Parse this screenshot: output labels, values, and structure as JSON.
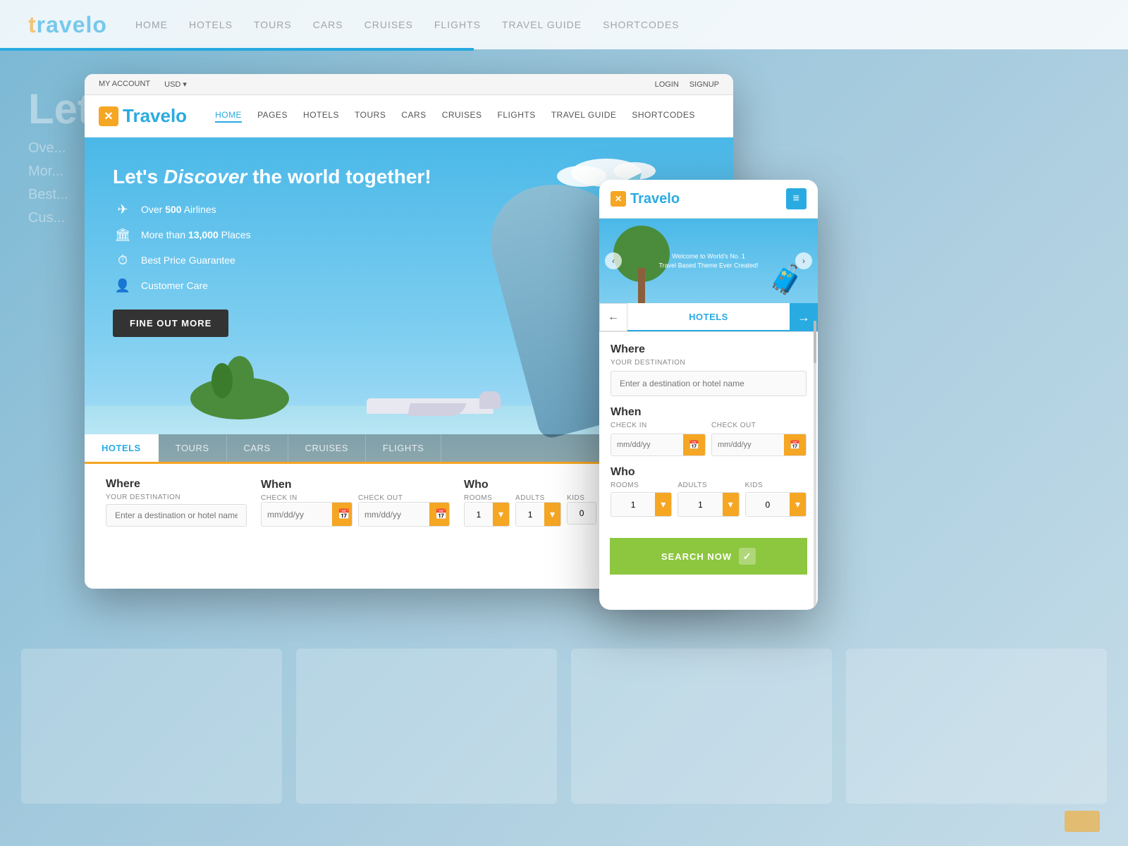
{
  "background": {
    "nav": {
      "logo": "Travelo",
      "logo_prefix": "t",
      "items": [
        "HOME",
        "HOTELS",
        "TOURS",
        "CARS",
        "CRUISES",
        "FLIGHTS",
        "TRAVEL GUIDE",
        "SHORTCODES"
      ]
    },
    "hero": {
      "title_prefix": "Let's",
      "title_highlight": "Discover",
      "title_suffix": "the world together!"
    }
  },
  "desktop": {
    "topbar": {
      "my_account": "MY ACCOUNT",
      "currency": "USD",
      "login": "LOGIN",
      "signup": "SIGNUP"
    },
    "nav": {
      "logo": "Travelo",
      "links": [
        "HOME",
        "PAGES",
        "HOTELS",
        "TOURS",
        "CARS",
        "CRUISES",
        "FLIGHTS",
        "TRAVEL GUIDE",
        "SHORTCODES"
      ],
      "active_link": "HOME"
    },
    "hero": {
      "title_prefix": "Let's ",
      "title_highlight": "Discover",
      "title_suffix": " the world together!",
      "features": [
        {
          "icon": "✈",
          "text_prefix": "Over ",
          "text_bold": "500",
          "text_suffix": " Airlines"
        },
        {
          "icon": "🏛",
          "text_prefix": "More than ",
          "text_bold": "13,000",
          "text_suffix": " Places"
        },
        {
          "icon": "⏱",
          "text": "Best Price Guarantee"
        },
        {
          "icon": "👤",
          "text": "Customer Care"
        }
      ],
      "cta_button": "FINE OUT MORE"
    },
    "search_tabs": [
      "HOTELS",
      "TOURS",
      "CARS",
      "CRUISES",
      "FLIGHTS"
    ],
    "active_tab": "HOTELS",
    "search_form": {
      "where_label": "Where",
      "destination_label": "YOUR DESTINATION",
      "destination_placeholder": "Enter a destination or hotel name",
      "when_label": "When",
      "checkin_label": "CHECK IN",
      "checkin_placeholder": "mm/dd/yy",
      "checkout_label": "CHECK OUT",
      "checkout_placeholder": "mm/dd/yy",
      "who_label": "Who",
      "rooms_label": "ROOMS",
      "rooms_value": "1",
      "adults_label": "ADULTS",
      "adults_value": "1",
      "kids_label": "KIDS",
      "kids_value": "0"
    }
  },
  "mobile": {
    "logo": "Travelo",
    "logo_prefix": "x",
    "hero_text_line1": "Welcome to World's No. 1",
    "hero_text_line2": "Travel Based Theme Ever Created!",
    "tabs": {
      "prev": "←",
      "active": "HOTELS",
      "next": "→"
    },
    "search_form": {
      "where_label": "Where",
      "destination_label": "YOUR DESTINATION",
      "destination_placeholder": "Enter a destination or hotel name",
      "when_label": "When",
      "checkin_label": "CHECK IN",
      "checkin_placeholder": "mm/dd/yy",
      "checkout_label": "CHECK OUT",
      "checkout_placeholder": "mm/dd/yy",
      "who_label": "Who",
      "rooms_label": "ROOMS",
      "rooms_value": "1",
      "adults_label": "ADULTS",
      "adults_value": "1",
      "kids_label": "KIDS",
      "kids_value": "0",
      "search_button": "SEARCH NOW",
      "check_icon": "✓"
    }
  }
}
